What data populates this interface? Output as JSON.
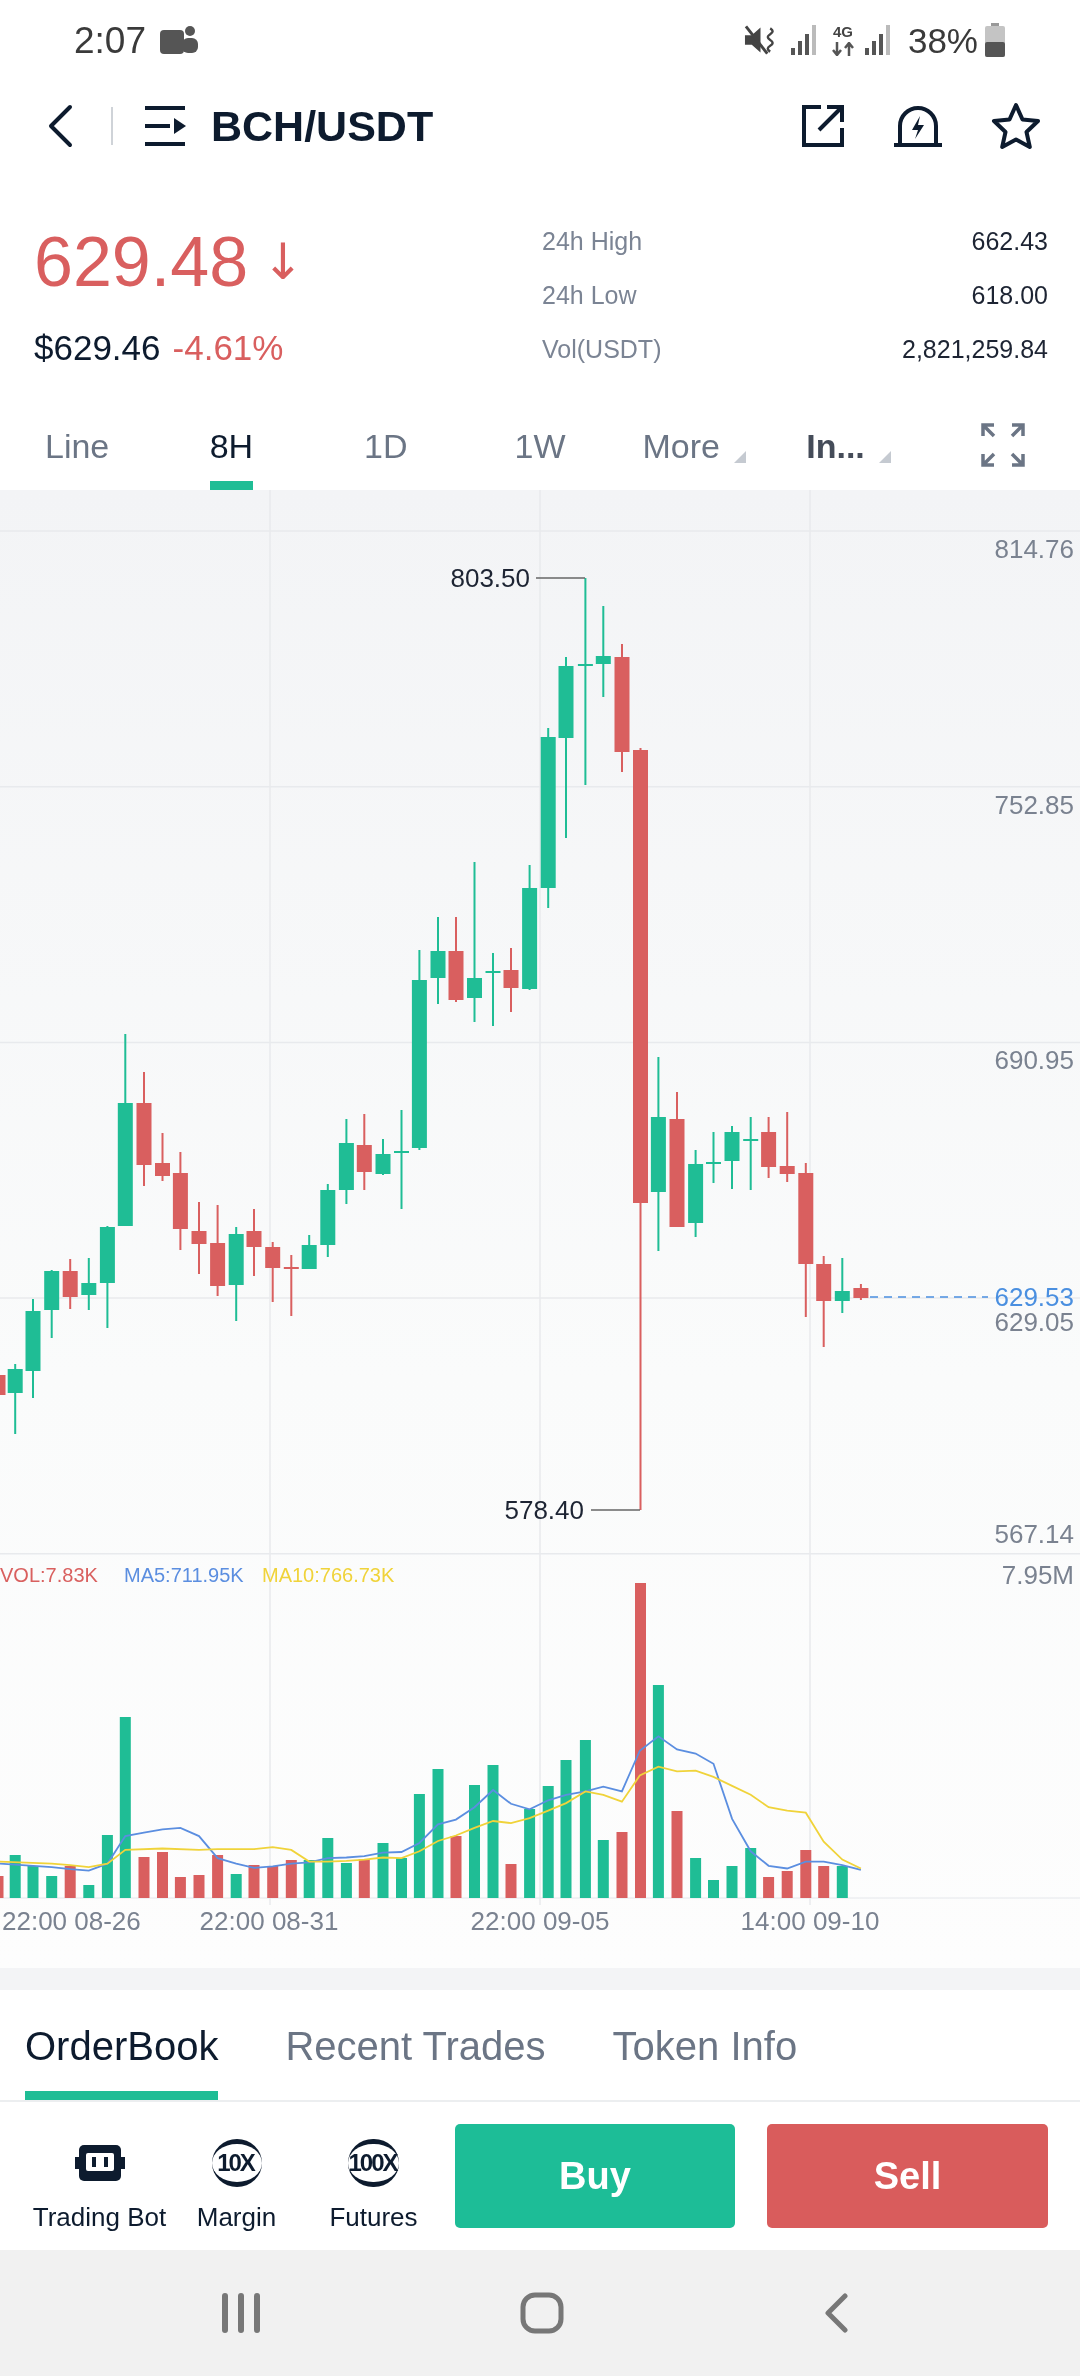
{
  "status_bar": {
    "time": "2:07",
    "network": "4G",
    "battery": "38%"
  },
  "header": {
    "title": "BCH/USDT",
    "favorite": false
  },
  "ticker": {
    "price": "629.48",
    "falling": true,
    "arrow": "↓",
    "fiat_price": "$629.46",
    "change": "-4.61%",
    "stats": [
      {
        "label": "24h High",
        "value": "662.43"
      },
      {
        "label": "24h Low",
        "value": "618.00"
      },
      {
        "label": "Vol(USDT)",
        "value": "2,821,259.84"
      }
    ]
  },
  "interval_tabs": [
    {
      "label": "Line",
      "kind": "tab",
      "selected": false,
      "active": false
    },
    {
      "label": "8H",
      "kind": "tab",
      "selected": true,
      "active": false
    },
    {
      "label": "1D",
      "kind": "tab",
      "selected": false,
      "active": false
    },
    {
      "label": "1W",
      "kind": "tab",
      "selected": false,
      "active": false
    },
    {
      "label": "More",
      "kind": "dropdown",
      "selected": false,
      "active": false
    },
    {
      "label": "In...",
      "kind": "dropdown",
      "selected": false,
      "active": true
    }
  ],
  "chart": {
    "price_axis_labels": [
      "814.76",
      "752.85",
      "690.95",
      "629.05",
      "567.14"
    ],
    "high_label": "803.50",
    "low_label": "578.40",
    "last_price_label": "629.53",
    "volume_legend": [
      {
        "text": "VOL:7.83K",
        "color": "#d9605f"
      },
      {
        "text": "MA5:711.95K",
        "color": "#5b8ee0"
      },
      {
        "text": "MA10:766.73K",
        "color": "#f0d33a"
      }
    ],
    "volume_axis_label": "7.95M",
    "time_axis_labels": [
      "22:00 08-26",
      "22:00 08-31",
      "22:00 09-05",
      "14:00 09-10"
    ]
  },
  "bottom_tabs": [
    {
      "label": "OrderBook",
      "selected": true
    },
    {
      "label": "Recent Trades",
      "selected": false
    },
    {
      "label": "Token Info",
      "selected": false
    }
  ],
  "shortcuts": [
    {
      "kind": "bot",
      "label": "Trading Bot"
    },
    {
      "kind": "leverage",
      "badge": "10X",
      "label": "Margin"
    },
    {
      "kind": "leverage",
      "badge": "100X",
      "label": "Futures"
    }
  ],
  "trade_buttons": [
    {
      "kind": "buy",
      "label": "Buy"
    },
    {
      "kind": "sell",
      "label": "Sell"
    }
  ]
}
